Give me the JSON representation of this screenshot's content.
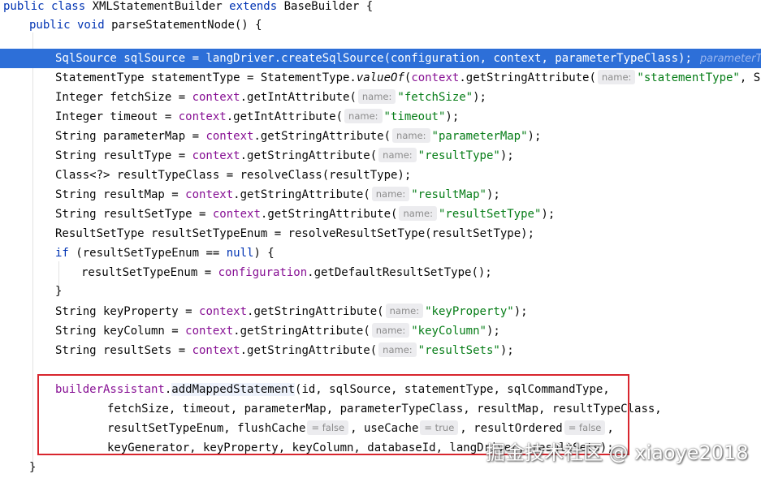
{
  "code": {
    "l0": {
      "kw1": "public class ",
      "name": "XMLStatementBuilder ",
      "kw2": "extends ",
      "parent": "BaseBuilder {"
    },
    "l1": {
      "kw1": "public void ",
      "name": "parseStatementNode() {"
    },
    "l3": {
      "text": "SqlSource sqlSource = langDriver.createSqlSource(configuration, context, parameterTypeClass);",
      "inlay": "parameterType"
    },
    "l4": {
      "a": "StatementType statementType = StatementType.",
      "b": "valueOf",
      "c": "(",
      "d": "context",
      ".e": "",
      "e": ".getStringAttribute(",
      "hint": "name:",
      "str": "\"statementType\"",
      "f": ", StatementType.PREPARED.toString()));"
    },
    "l5": {
      "a": "Integer fetchSize = ",
      "fld": "context",
      "b": ".getIntAttribute(",
      "hint": "name:",
      "str": "\"fetchSize\"",
      "c": ");"
    },
    "l6": {
      "a": "Integer timeout = ",
      "fld": "context",
      "b": ".getIntAttribute(",
      "hint": "name:",
      "str": "\"timeout\"",
      "c": ");"
    },
    "l7": {
      "a": "String parameterMap = ",
      "fld": "context",
      "b": ".getStringAttribute(",
      "hint": "name:",
      "str": "\"parameterMap\"",
      "c": ");"
    },
    "l8": {
      "a": "String resultType = ",
      "fld": "context",
      "b": ".getStringAttribute(",
      "hint": "name:",
      "str": "\"resultType\"",
      "c": ");"
    },
    "l9": {
      "text": "Class<?> resultTypeClass = resolveClass(resultType);"
    },
    "l10": {
      "a": "String resultMap = ",
      "fld": "context",
      "b": ".getStringAttribute(",
      "hint": "name:",
      "str": "\"resultMap\"",
      "c": ");"
    },
    "l11": {
      "a": "String resultSetType = ",
      "fld": "context",
      "b": ".getStringAttribute(",
      "hint": "name:",
      "str": "\"resultSetType\"",
      "c": ");"
    },
    "l12": {
      "text": "ResultSetType resultSetTypeEnum = resolveResultSetType(resultSetType);"
    },
    "l13": {
      "kw": "if ",
      "a": "(resultSetTypeEnum == ",
      "kw2": "null",
      "b": ") {"
    },
    "l14": {
      "a": "resultSetTypeEnum = ",
      "fld": "configuration",
      "b": ".getDefaultResultSetType();"
    },
    "l15": {
      "text": "}"
    },
    "l16": {
      "a": "String keyProperty = ",
      "fld": "context",
      "b": ".getStringAttribute(",
      "hint": "name:",
      "str": "\"keyProperty\"",
      "c": ");"
    },
    "l17": {
      "a": "String keyColumn = ",
      "fld": "context",
      "b": ".getStringAttribute(",
      "hint": "name:",
      "str": "\"keyColumn\"",
      "c": ");"
    },
    "l18": {
      "a": "String resultSets = ",
      "fld": "context",
      "b": ".getStringAttribute(",
      "hint": "name:",
      "str": "\"resultSets\"",
      "c": ");"
    },
    "l20": {
      "fld": "builderAssistant",
      "a": ".",
      "m": "addMappedStatement",
      "b": "(id, sqlSource, statementType, sqlCommandType,"
    },
    "l21": {
      "text": "fetchSize, timeout, parameterMap, parameterTypeClass, resultMap, resultTypeClass,"
    },
    "l22": {
      "a": "resultSetTypeEnum, flushCache",
      "h1": "= false",
      "b": ", useCache",
      "h2": "= true",
      "c": ", resultOrdered",
      "h3": "= false",
      "d": ","
    },
    "l23": {
      "text": "keyGenerator, keyProperty, keyColumn, databaseId, langDriver, resultSets);"
    },
    "l24": {
      "text": "}"
    }
  },
  "watermark": "掘金技术社区 @ xiaoye2018"
}
